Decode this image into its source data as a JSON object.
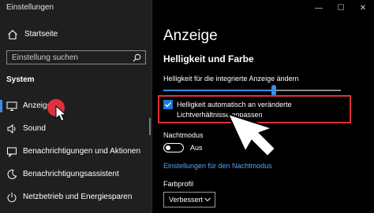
{
  "window": {
    "title": "Einstellungen",
    "controls": [
      "—",
      "☐",
      "✕"
    ]
  },
  "sidebar": {
    "home_label": "Startseite",
    "search_placeholder": "Einstellung suchen",
    "section_label": "System",
    "items": [
      {
        "label": "Anzeige",
        "icon": "monitor-icon",
        "active": true
      },
      {
        "label": "Sound",
        "icon": "speaker-icon"
      },
      {
        "label": "Benachrichtigungen und Aktionen",
        "icon": "notification-icon"
      },
      {
        "label": "Benachrichtigungsassistent",
        "icon": "moon-icon"
      },
      {
        "label": "Netzbetrieb und Energiesparen",
        "icon": "power-icon"
      }
    ]
  },
  "main": {
    "page_title": "Anzeige",
    "section_title": "Helligkeit und Farbe",
    "brightness_label": "Helligkeit für die integrierte Anzeige ändern",
    "brightness_level": 0.62,
    "auto_brightness_label": "Helligkeit automatisch an veränderte Lichtverhältnisse anpassen",
    "auto_brightness_checked": true,
    "night_mode_label": "Nachtmodus",
    "night_mode_state": "Aus",
    "night_mode_link": "Einstellungen für den Nachtmodus",
    "color_profile_label": "Farbprofil",
    "color_profile_value": "Verbessert"
  },
  "colors": {
    "accent": "#3a8ee6",
    "highlight": "#e0303a",
    "sidebar_bg": "#1f1f1f",
    "main_bg": "#000000",
    "link": "#5aa5f0"
  }
}
